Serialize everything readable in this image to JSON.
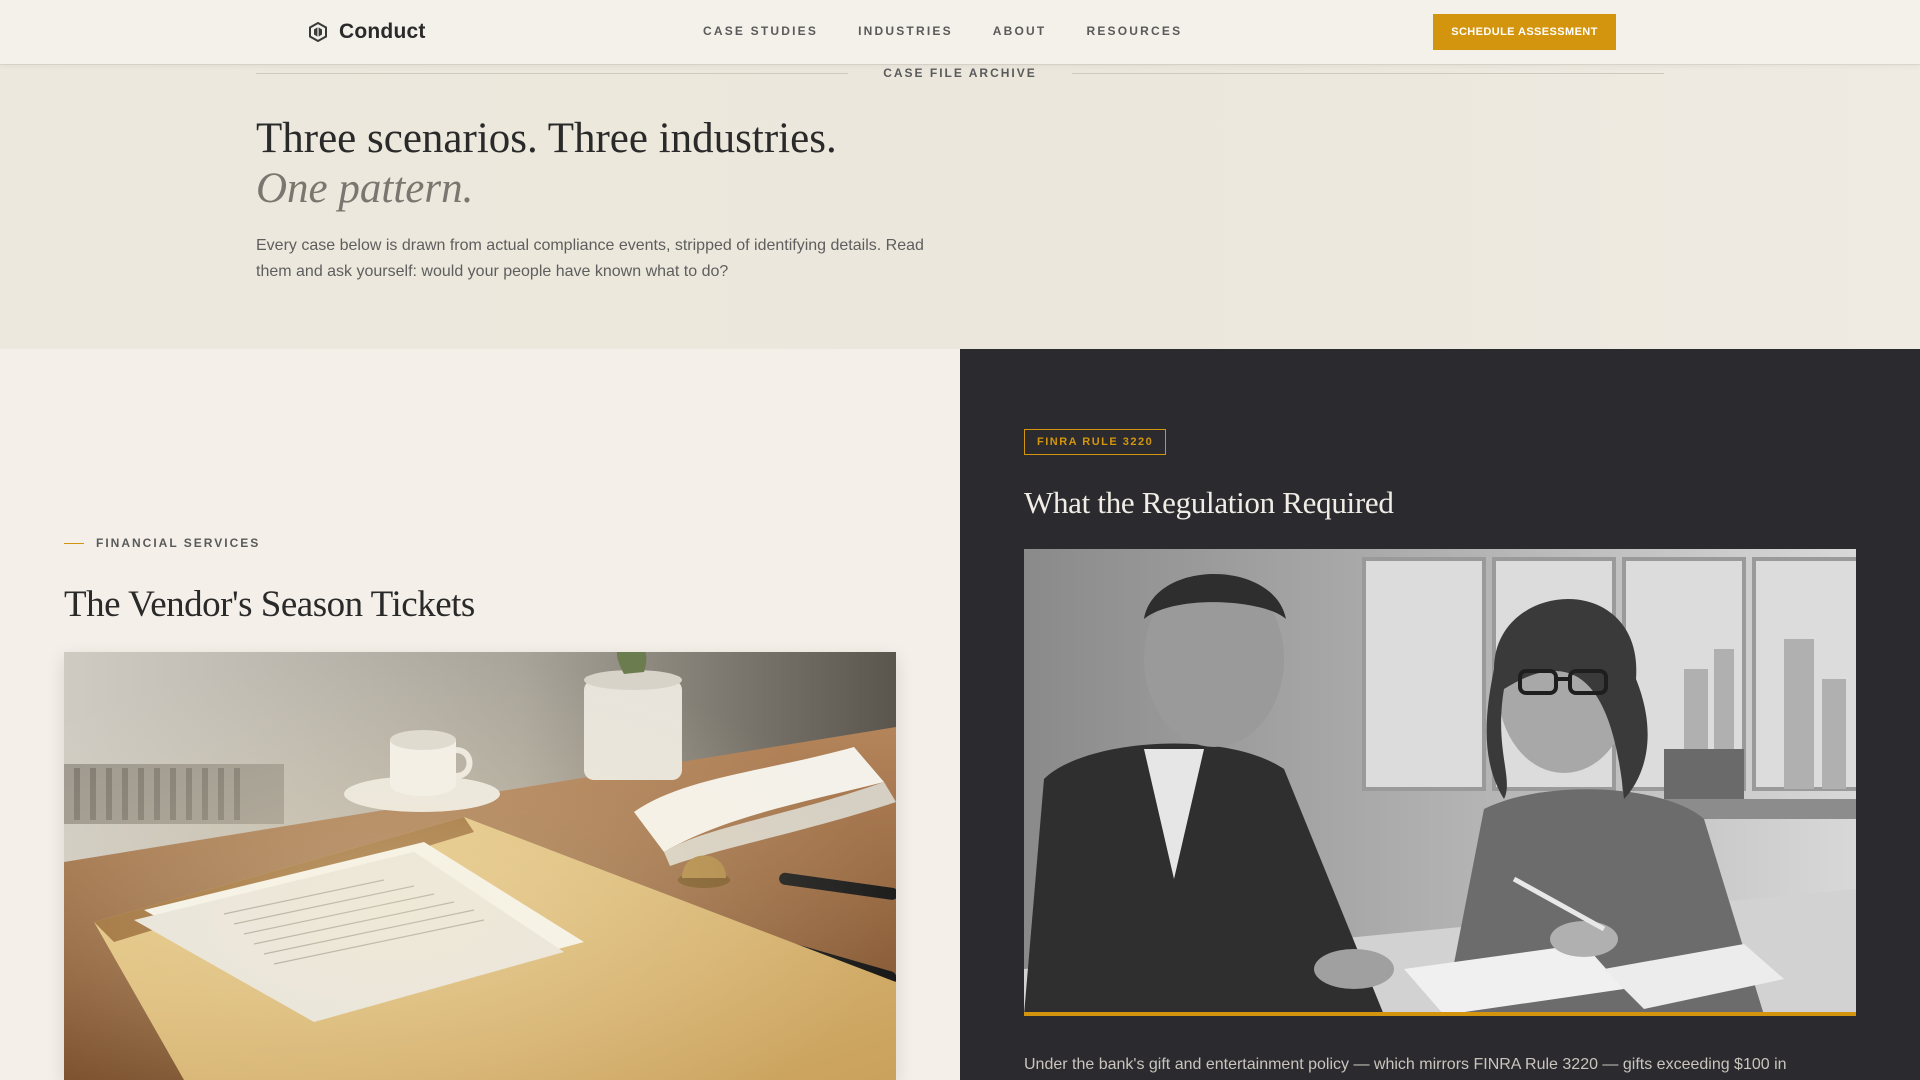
{
  "nav": {
    "brand": "Conduct",
    "brand_icon": "hexagon-logo-icon",
    "links": [
      "CASE STUDIES",
      "INDUSTRIES",
      "ABOUT",
      "RESOURCES"
    ],
    "cta": "SCHEDULE ASSESSMENT"
  },
  "hero": {
    "eyebrow": "CASE FILE ARCHIVE",
    "title": "Three scenarios. Three industries.",
    "title_italic": "One pattern.",
    "description": "Every case below is drawn from actual compliance events, stripped of identifying details. Read them and ask yourself: would your people have known what to do?"
  },
  "case": {
    "industry": "FINANCIAL SERVICES",
    "title": "The Vendor's Season Tickets"
  },
  "regulation": {
    "badge": "FINRA RULE 3220",
    "title": "What the Regulation Required",
    "body": "Under the bank's gift and entertainment policy — which mirrors FINRA Rule 3220 — gifts exceeding $100 in"
  },
  "colors": {
    "accent": "#d4950e",
    "dark_panel": "#2b2b2f",
    "background": "#f3efe8"
  }
}
